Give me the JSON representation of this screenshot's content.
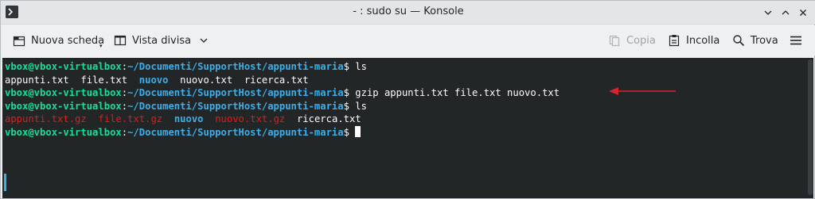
{
  "window": {
    "title": "- : sudo su — Konsole"
  },
  "toolbar": {
    "new_tab_label": "Nuova scheda",
    "split_view_label": "Vista divisa",
    "copy_label": "Copia",
    "paste_label": "Incolla",
    "find_label": "Trova"
  },
  "terminal": {
    "prompt_user": "vbox@vbox-virtualbox",
    "prompt_sep": ":",
    "prompt_path": "~/Documenti/SupportHost/appunti-maria",
    "prompt_symbol": "$",
    "lines": [
      {
        "type": "prompt",
        "command": " ls"
      },
      {
        "type": "output",
        "items": [
          {
            "text": "appunti.txt",
            "color": "white"
          },
          {
            "text": "file.txt",
            "color": "white"
          },
          {
            "text": "nuovo",
            "color": "blue"
          },
          {
            "text": "nuovo.txt",
            "color": "white"
          },
          {
            "text": "ricerca.txt",
            "color": "white"
          }
        ]
      },
      {
        "type": "prompt",
        "command": " gzip appunti.txt file.txt nuovo.txt"
      },
      {
        "type": "prompt",
        "command": " ls"
      },
      {
        "type": "output",
        "items": [
          {
            "text": "appunti.txt.gz",
            "color": "red"
          },
          {
            "text": "file.txt.gz",
            "color": "red"
          },
          {
            "text": "nuovo",
            "color": "blue"
          },
          {
            "text": "nuovo.txt.gz",
            "color": "red"
          },
          {
            "text": "ricerca.txt",
            "color": "white"
          }
        ]
      },
      {
        "type": "prompt",
        "command": " "
      }
    ]
  },
  "colors": {
    "terminal_bg": "#232627",
    "prompt_green": "#1cdc9a",
    "dir_blue": "#3daee9",
    "archive_red": "#ed1515",
    "annotation_arrow": "#d9232a"
  },
  "icons": {
    "app": "terminal-app-icon",
    "new_tab": "new-tab-icon",
    "split_view": "split-view-icon",
    "copy": "copy-icon",
    "paste": "paste-icon",
    "find": "search-icon",
    "menu": "hamburger-menu-icon"
  }
}
